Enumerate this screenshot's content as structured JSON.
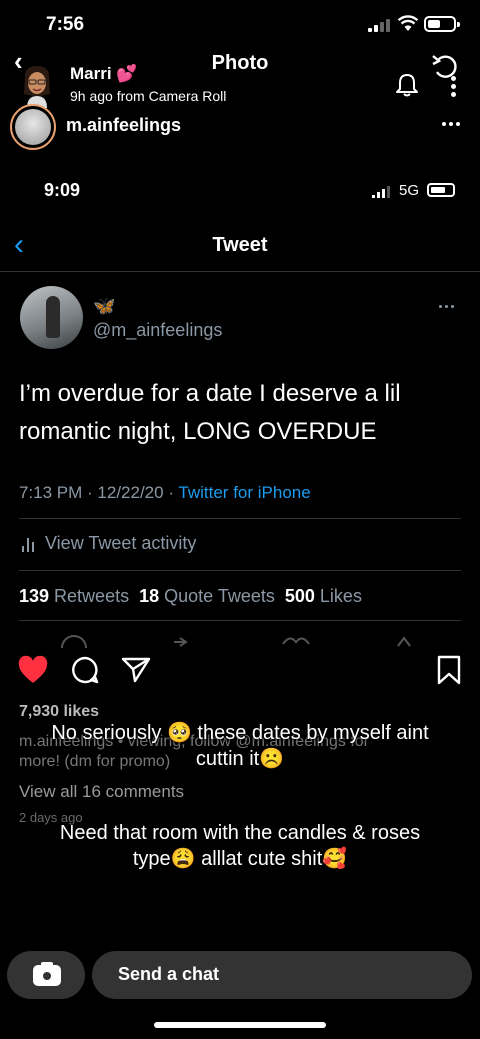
{
  "status_bar": {
    "time": "7:56"
  },
  "snap_header": {
    "title": "Photo",
    "sender_name": "Marri 💕",
    "sender_subtitle": "9h ago from Camera Roll",
    "account_name": "m.ainfeelings"
  },
  "inner_status_bar": {
    "time": "9:09",
    "network": "5G"
  },
  "tweet_screen": {
    "title": "Tweet",
    "butterfly_emoji": "🦋",
    "handle": "@m_ainfeelings",
    "text": "I’m overdue for a date I deserve a lil romantic night, LONG OVERDUE",
    "meta_time": "7:13 PM · 12/22/20 · ",
    "meta_source": "Twitter for iPhone",
    "activity_label": "View Tweet activity",
    "retweets_count": "139",
    "retweets_label": " Retweets  ",
    "quotes_count": "18",
    "quotes_label": " Quote Tweets  ",
    "likes_count": "500",
    "likes_label": " Likes"
  },
  "instagram_post": {
    "likes": "7,930 likes",
    "caption_line1": "m.ainfeelings • viewing, follow @m.ainfeelings for",
    "caption_line2": "more! (dm for promo)",
    "view_comments": "View all 16 comments",
    "post_date": "2 days ago"
  },
  "overlay_text": {
    "line1": "No seriously 🥺 these dates by myself aint",
    "line2": "cuttin it☹️",
    "line3": "Need that room with the candles & roses",
    "line4": "type😩 alllat cute shit🥰"
  },
  "chat_bar": {
    "placeholder": "Send a chat"
  },
  "colors": {
    "twitter_blue": "#1d9bf0",
    "heart_red": "#ff3040",
    "muted": "#8b98a5"
  }
}
